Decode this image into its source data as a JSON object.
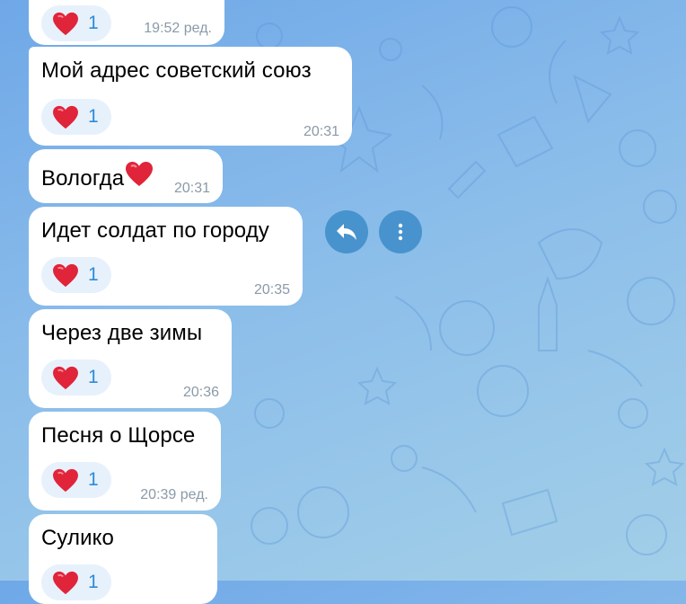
{
  "messages": [
    {
      "text": "",
      "time": "19:52 ред.",
      "reaction": {
        "emoji": "heart",
        "count": "1"
      }
    },
    {
      "text": "Мой адрес советский союз",
      "time": "20:31",
      "reaction": {
        "emoji": "heart",
        "count": "1"
      }
    },
    {
      "text": "Вологда",
      "time": "20:31",
      "reaction": null
    },
    {
      "text": "Идет солдат по городу",
      "time": "20:35",
      "reaction": {
        "emoji": "heart",
        "count": "1"
      }
    },
    {
      "text": "Через две зимы",
      "time": "20:36",
      "reaction": {
        "emoji": "heart",
        "count": "1"
      }
    },
    {
      "text": "Песня о Щорсе",
      "time": "20:39 ред.",
      "reaction": {
        "emoji": "heart",
        "count": "1"
      }
    },
    {
      "text": "Сулико",
      "time": "",
      "reaction": {
        "emoji": "heart",
        "count": "1"
      }
    }
  ],
  "actions": {
    "reply_icon": "reply-icon",
    "more_icon": "more-vertical-icon"
  },
  "colors": {
    "accent": "#2e8bd8",
    "reaction_bg": "#e7f1fb",
    "bubble": "#ffffff",
    "time": "#8a9aa8",
    "heart": "#e0243a"
  }
}
